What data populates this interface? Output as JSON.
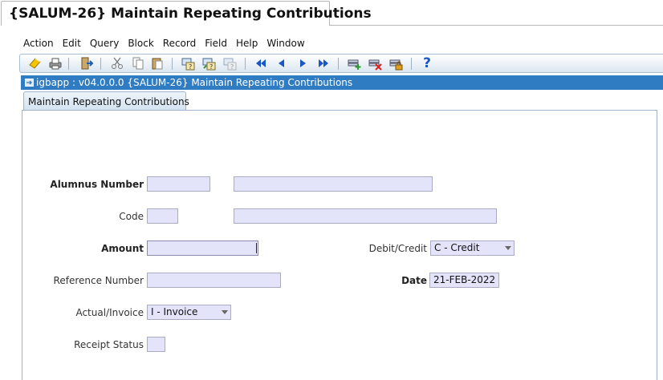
{
  "window": {
    "title": "{SALUM-26} Maintain Repeating Contributions"
  },
  "menu": [
    "Action",
    "Edit",
    "Query",
    "Block",
    "Record",
    "Field",
    "Help",
    "Window"
  ],
  "toolbar": {
    "help_glyph": "?"
  },
  "form": {
    "title": "igbapp : v04.0.0.0  {SALUM-26} Maintain Repeating Contributions",
    "tab_label": "Maintain Repeating Contributions"
  },
  "fields": {
    "alumnus_number_label": "Alumnus Number",
    "alumnus_number_value": "",
    "alumnus_name_value": "",
    "code_label": "Code",
    "code_value": "",
    "code_description_value": "",
    "amount_label": "Amount",
    "amount_value": "",
    "reference_number_label": "Reference Number",
    "reference_number_value": "",
    "actual_invoice_label": "Actual/Invoice",
    "actual_invoice_value": "I - Invoice",
    "receipt_status_label": "Receipt Status",
    "receipt_status_value": "",
    "debit_credit_label": "Debit/Credit",
    "debit_credit_value": "C - Credit",
    "date_label": "Date",
    "date_value": "21-FEB-2022"
  }
}
